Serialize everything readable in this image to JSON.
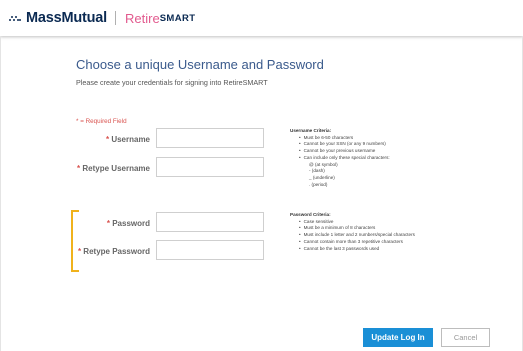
{
  "header": {
    "logo_dots_icon": "massmutual-dots-icon",
    "brand_name": "MassMutual",
    "product_prefix": "Retire",
    "product_suffix": "SMART"
  },
  "form": {
    "title": "Choose a unique Username and Password",
    "subtitle": "Please create your credentials for signing into RetireSMART",
    "required_note": "* = Required Field",
    "required_star": "*",
    "fields": {
      "username": {
        "label": "Username",
        "value": ""
      },
      "retype_username": {
        "label": "Retype Username",
        "value": ""
      },
      "password": {
        "label": "Password",
        "value": ""
      },
      "retype_password": {
        "label": "Retype Password",
        "value": ""
      }
    }
  },
  "username_criteria": {
    "title": "Username Criteria:",
    "items": [
      "Must be 6-50 characters",
      "Cannot be your SSN (or any 9 numbers)",
      "Cannot be your previous username",
      "Can include only these special characters:"
    ],
    "special_chars": [
      "@ (at symbol)",
      "- (dash)",
      "_ (underline)",
      ". (period)"
    ]
  },
  "password_criteria": {
    "title": "Password Criteria:",
    "items": [
      "Case sensitive",
      "Must be a minimum of 8 characters",
      "Must include 1 letter and 2 numbers/special characters",
      "Cannot contain more than 3 repetitive characters",
      "Cannot be the last 3 passwords used"
    ]
  },
  "actions": {
    "update_label": "Update Log In",
    "cancel_label": "Cancel"
  },
  "colors": {
    "brand_navy": "#0b2a52",
    "brand_pink": "#e25a8e",
    "title_blue": "#3a5a8c",
    "required_red": "#d9534f",
    "button_blue": "#1a8fd6",
    "highlight_gold": "#f0b21c"
  }
}
